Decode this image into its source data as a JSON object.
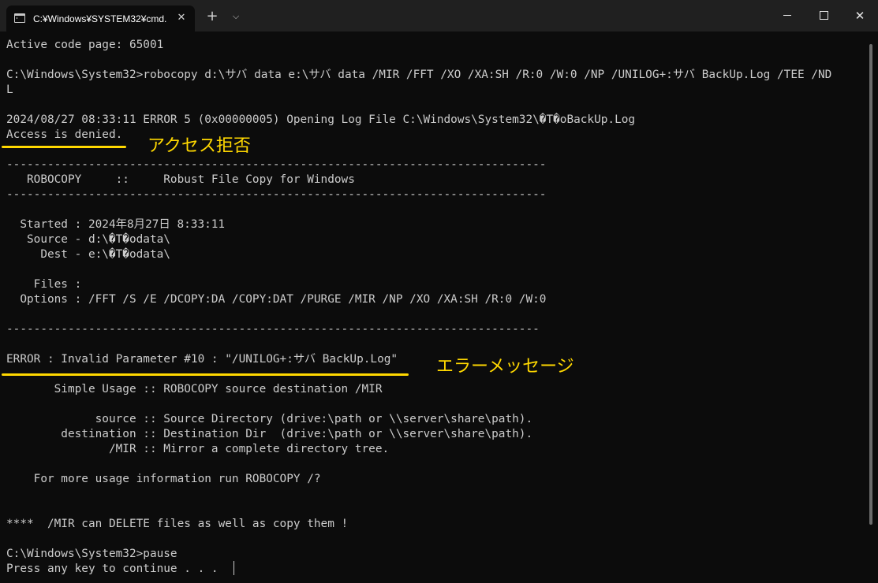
{
  "titlebar": {
    "tab_title": "C:¥Windows¥SYSTEM32¥cmd.",
    "new_tab": "+",
    "dropdown": "⌵",
    "close_tab": "✕",
    "close_window": "✕"
  },
  "terminal": {
    "lines": [
      "Active code page: 65001",
      "",
      "C:\\Windows\\System32>robocopy d:\\サバ data e:\\サバ data /MIR /FFT /XO /XA:SH /R:0 /W:0 /NP /UNILOG+:サバ BackUp.Log /TEE /ND",
      "L",
      "",
      "2024/08/27 08:33:11 ERROR 5 (0x00000005) Opening Log File C:\\Windows\\System32\\�T�oBackUp.Log",
      "Access is denied.",
      "",
      "-------------------------------------------------------------------------------",
      "   ROBOCOPY     ::     Robust File Copy for Windows",
      "-------------------------------------------------------------------------------",
      "",
      "  Started : 2024年8月27日 8:33:11",
      "   Source - d:\\�T�odata\\",
      "     Dest - e:\\�T�odata\\",
      "",
      "    Files :",
      "  Options : /FFT /S /E /DCOPY:DA /COPY:DAT /PURGE /MIR /NP /XO /XA:SH /R:0 /W:0",
      "",
      "------------------------------------------------------------------------------",
      "",
      "ERROR : Invalid Parameter #10 : \"/UNILOG+:サバ BackUp.Log\"",
      "",
      "       Simple Usage :: ROBOCOPY source destination /MIR",
      "",
      "             source :: Source Directory (drive:\\path or \\\\server\\share\\path).",
      "        destination :: Destination Dir  (drive:\\path or \\\\server\\share\\path).",
      "               /MIR :: Mirror a complete directory tree.",
      "",
      "    For more usage information run ROBOCOPY /?",
      "",
      "",
      "****  /MIR can DELETE files as well as copy them !",
      "",
      "C:\\Windows\\System32>pause",
      "Press any key to continue . . . "
    ]
  },
  "annotations": {
    "access_denied_label": "アクセス拒否",
    "error_message_label": "エラーメッセージ"
  },
  "colors": {
    "terminal_bg": "#0c0c0c",
    "terminal_text": "#cccccc",
    "titlebar_bg": "#202020",
    "annotation": "#ffd800"
  }
}
